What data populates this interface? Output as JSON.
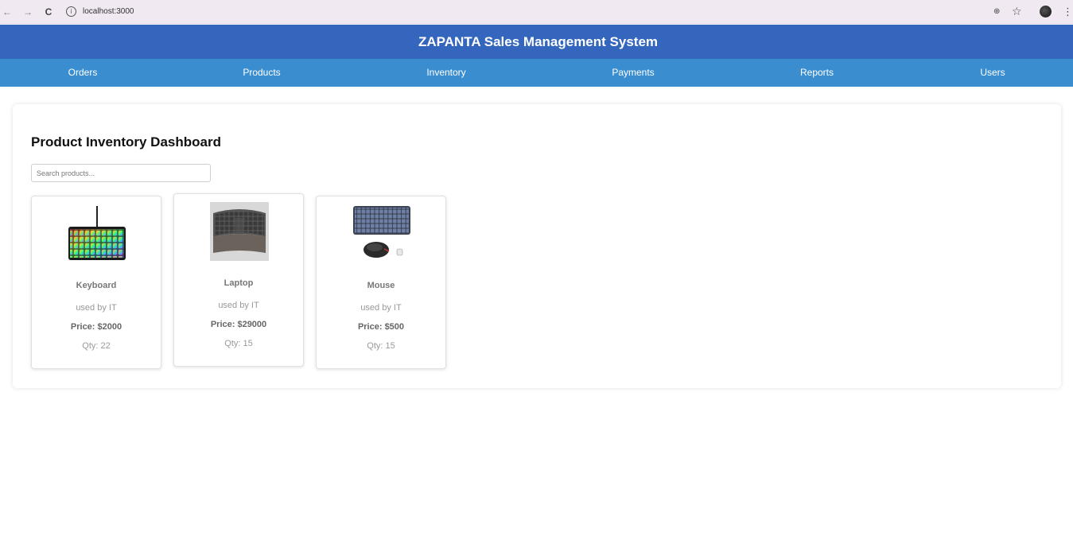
{
  "browser": {
    "url": "localhost:3000",
    "back_icon": "←",
    "forward_icon": "→",
    "reload_icon": "C",
    "info_icon": "i",
    "key_icon": "⊕",
    "star_icon": "☆",
    "menu_icon": "⋮"
  },
  "header": {
    "title": "ZAPANTA Sales Management System"
  },
  "nav": {
    "orders": "Orders",
    "products": "Products",
    "inventory": "Inventory",
    "payments": "Payments",
    "reports": "Reports",
    "users": "Users"
  },
  "main": {
    "title": "Product Inventory Dashboard",
    "search_placeholder": "Search products...",
    "products": [
      {
        "name": "Keyboard",
        "description": "used by IT",
        "price": "Price: $2000",
        "qty": "Qty: 22",
        "image": "rgb-keyboard-image"
      },
      {
        "name": "Laptop",
        "description": "used by IT",
        "price": "Price: $29000",
        "qty": "Qty: 15",
        "image": "ergonomic-keyboard-image"
      },
      {
        "name": "Mouse",
        "description": "used by IT",
        "price": "Price: $500",
        "qty": "Qty: 15",
        "image": "keyboard-mouse-combo-image"
      }
    ]
  },
  "colors": {
    "header_bg": "#3466bd",
    "nav_bg": "#3a8ed0",
    "browser_bar_bg": "#f1e9f1"
  }
}
